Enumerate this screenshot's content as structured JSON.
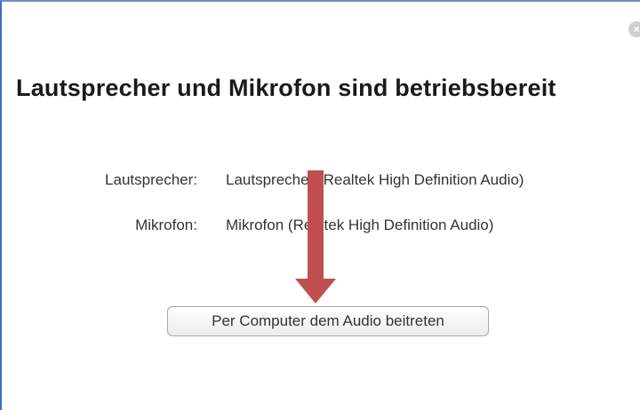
{
  "dialog": {
    "title": "Lautsprecher und Mikrofon sind betriebsbereit",
    "close_icon": "close-icon",
    "rows": [
      {
        "label": "Lautsprecher:",
        "value": "Lautsprecher (Realtek High Definition Audio)"
      },
      {
        "label": "Mikrofon:",
        "value": "Mikrofon (Realtek High Definition Audio)"
      }
    ],
    "join_button_label": "Per Computer dem Audio beitreten"
  },
  "annotation": {
    "arrow_icon": "down-arrow-icon",
    "arrow_color": "#c0504d"
  },
  "colors": {
    "window_border": "#3c6fbe",
    "text": "#333333",
    "title": "#1a1a1a"
  }
}
